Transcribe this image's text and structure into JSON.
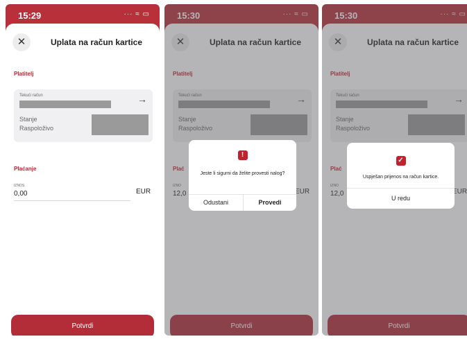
{
  "screens": [
    {
      "time": "15:29",
      "title": "Uplata na račun kartice",
      "payer_label": "Platitelj",
      "account_label": "Tekući račun",
      "balance_label": "Stanje",
      "available_label": "Raspoloživo",
      "payment_label": "Plaćanje",
      "amount_label": "IZNOS",
      "amount_value": "0,00",
      "currency": "EUR",
      "confirm_label": "Potvrdi"
    },
    {
      "time": "15:30",
      "title": "Uplata na račun kartice",
      "payer_label": "Platitelj",
      "account_label": "Tekući račun",
      "balance_label": "Stanje",
      "available_label": "Raspoloživo",
      "payment_label": "Plać",
      "amount_label": "IZNO",
      "amount_value": "12,0",
      "currency": "EUR",
      "confirm_label": "Potvrdi",
      "dialog": {
        "icon": "info-icon",
        "message": "Jeste li sigurni da želite provesti nalog?",
        "cancel_label": "Odustani",
        "execute_label": "Provedi"
      }
    },
    {
      "time": "15:30",
      "title": "Uplata na račun kartice",
      "payer_label": "Platitelj",
      "account_label": "Tekući račun",
      "balance_label": "Stanje",
      "available_label": "Raspoloživo",
      "payment_label": "Plać",
      "amount_label": "IZNO",
      "amount_value": "12,0",
      "currency": "EUR",
      "confirm_label": "Potvrdi",
      "dialog": {
        "icon": "checkmark-icon",
        "message": "Uspješan prijenos na račun kartice.",
        "ok_label": "U redu"
      }
    }
  ],
  "icons": {
    "status": "···  ≈ ▭",
    "close": "✕",
    "arrow": "→",
    "info": "!",
    "check": "✓"
  },
  "colors": {
    "accent": "#c0222e",
    "header": "#b8303a",
    "button": "#b22d38"
  }
}
